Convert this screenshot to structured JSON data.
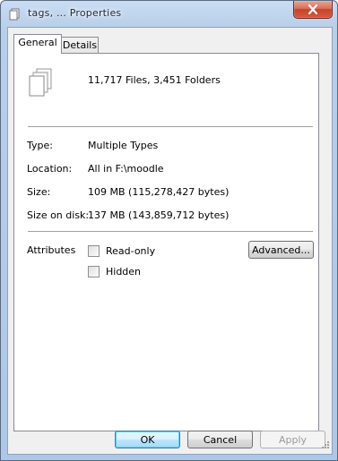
{
  "window": {
    "title": "tags, ... Properties"
  },
  "tabs": [
    {
      "label": "General",
      "active": true
    },
    {
      "label": "Details",
      "active": false
    }
  ],
  "general": {
    "summary": "11,717 Files, 3,451 Folders",
    "fields": {
      "type_label": "Type:",
      "type_value": "Multiple Types",
      "location_label": "Location:",
      "location_value": "All in F:\\moodle",
      "size_label": "Size:",
      "size_value": "109 MB (115,278,427 bytes)",
      "size_on_disk_label": "Size on disk:",
      "size_on_disk_value": "137 MB (143,859,712 bytes)"
    },
    "attributes": {
      "label": "Attributes",
      "readonly_label": "Read-only",
      "readonly_checked": false,
      "hidden_label": "Hidden",
      "hidden_checked": false,
      "advanced_label": "Advanced..."
    }
  },
  "buttons": {
    "ok": "OK",
    "cancel": "Cancel",
    "apply": "Apply"
  },
  "icons": {
    "title": "files-icon",
    "close": "close-icon",
    "summary": "multiple-files-icon",
    "resize": "resize-grip-icon"
  },
  "colors": {
    "close_button": "#c7432a",
    "ok_border": "#3c7fb1"
  }
}
